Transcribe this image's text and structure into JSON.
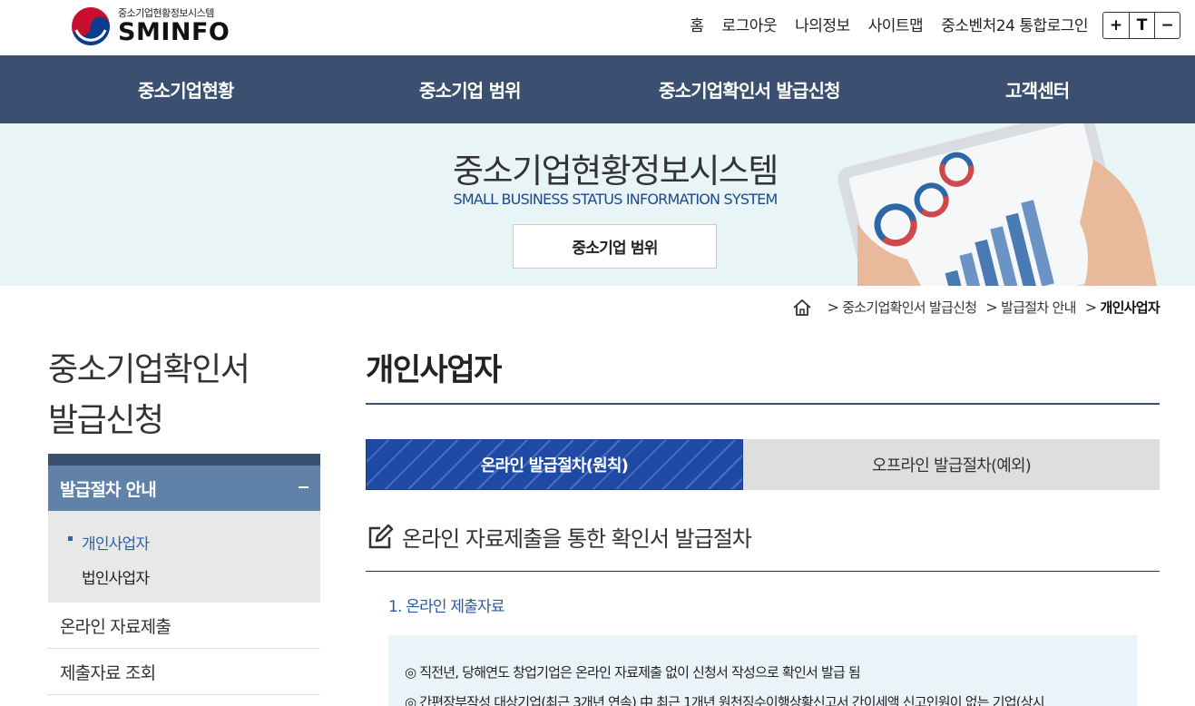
{
  "header": {
    "logo_sub": "중소기업현황정보시스템",
    "logo_main": "SMINFO",
    "util_links": [
      "홈",
      "로그아웃",
      "나의정보",
      "사이트맵",
      "중소벤처24 통합로그인"
    ],
    "font_controls": [
      "+",
      "T",
      "−"
    ]
  },
  "gnb": {
    "items": [
      "중소기업현황",
      "중소기업 범위",
      "중소기업확인서 발급신청",
      "고객센터"
    ]
  },
  "banner": {
    "title": "중소기업현황정보시스템",
    "subtitle": "SMALL BUSINESS STATUS INFORMATION SYSTEM",
    "button": "중소기업 범위"
  },
  "breadcrumb": {
    "items": [
      "중소기업확인서 발급신청",
      "발급절차 안내",
      "개인사업자"
    ]
  },
  "lnb": {
    "title_line1": "중소기업확인서",
    "title_line2": "발급신청",
    "active": "발급절차 안내",
    "sub_items": [
      "개인사업자",
      "법인사업자"
    ],
    "items": [
      "온라인 자료제출",
      "제출자료 조회"
    ]
  },
  "content": {
    "title": "개인사업자",
    "tabs": [
      "온라인 발급절차(원칙)",
      "오프라인 발급절차(예외)"
    ],
    "section_title": "온라인 자료제출을 통한 확인서 발급절차",
    "subhead": "1. 온라인 제출자료",
    "info_line1": "◎ 직전년, 당해연도 창업기업은 온라인 자료제출 없이 신청서 작성으로 확인서 발급 됨",
    "info_line2": "◎ 간편장부작성 대상기업(최근 3개년 연속) 中 최근 1개년 원천징수이행상황신고서 간이세액 신고인원이 없는 기업(상시"
  },
  "colors": {
    "nav_bg": "#3b5070",
    "banner_bg": "#e9f4f7",
    "active_menu": "#6081a8",
    "tab_active": "#1e4aa5",
    "link_blue": "#2b62a8"
  }
}
